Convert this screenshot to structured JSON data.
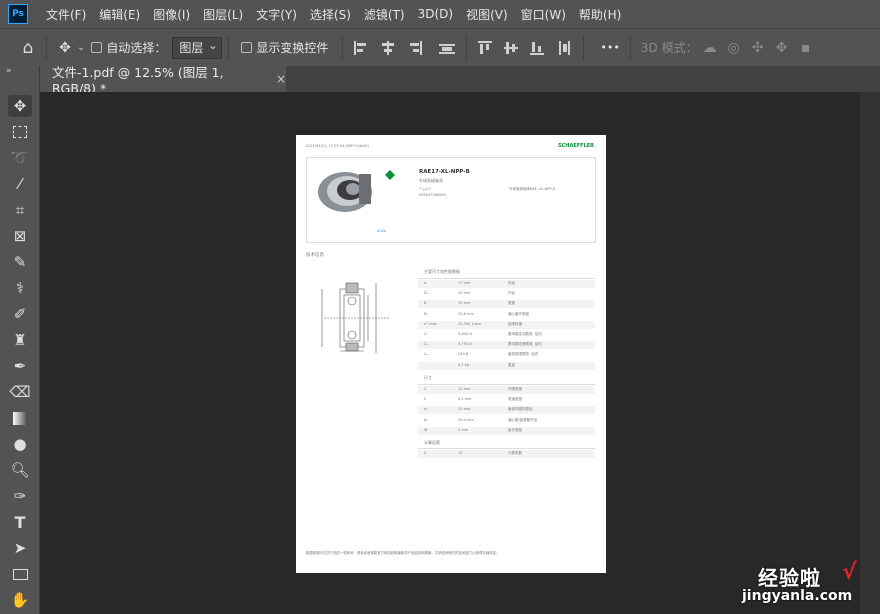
{
  "app": {
    "logo_text": "Ps"
  },
  "menu": [
    "文件(F)",
    "编辑(E)",
    "图像(I)",
    "图层(L)",
    "文字(Y)",
    "选择(S)",
    "滤镜(T)",
    "3D(D)",
    "视图(V)",
    "窗口(W)",
    "帮助(H)"
  ],
  "options": {
    "auto_select_label": "自动选择：",
    "layer_select_value": "图层",
    "show_transform_label": "显示变换控件",
    "more_label": "•••",
    "mode_3d_label": "3D 模式："
  },
  "document_tab": {
    "title": "文件-1.pdf @ 12.5% (图层 1, RGB/8) *",
    "close": "×"
  },
  "doc": {
    "timestamp": "2021/04/21, 17:25:04 (GMT+08:00)",
    "brand": "SCHAEFFLER",
    "product_name": "RAE17-XL-NPP-B",
    "product_sub": "外球面球轴承",
    "product_desc": "外球面球轴承RAE..XL-NPP-B",
    "order_label": "产品编号",
    "order_no": "039047580000",
    "xlife": "X-life",
    "section_tech": "技术信息",
    "table1_title": "主要尺寸和性能数据",
    "table1_rows": [
      [
        "d",
        "17 mm",
        "内径"
      ],
      [
        "Dₘ",
        "40 mm",
        "外径"
      ],
      [
        "B",
        "19 mm",
        "宽度"
      ],
      [
        "B₁",
        "20.6 mm",
        "偏心套环宽度"
      ],
      [
        "nᴳ max",
        "22,300 1/min",
        "极限转速"
      ],
      [
        "Cᵣ",
        "9,600 N",
        "基本额定动载荷, 径向"
      ],
      [
        "C₀ᵣ",
        "4,750 N",
        "基本额定静载荷, 径向"
      ],
      [
        "Cᵤᵣ",
        "240 N",
        "疲劳极限载荷, 径向"
      ],
      [
        "",
        "0.1 kg",
        "重量"
      ]
    ],
    "table2_title": "尺寸",
    "table2_rows": [
      [
        "C",
        "12 mm",
        "外圈宽度"
      ],
      [
        "S",
        "6.5 mm",
        "滚道宽度"
      ],
      [
        "d₁",
        "23 mm",
        "肩部内圈的直径"
      ],
      [
        "d₂",
        "26.4 mm",
        "偏心套/锁紧套外径"
      ],
      [
        "W",
        "3 mm",
        "扳手宽度"
      ]
    ],
    "table3_title": "计算因素",
    "table3_rows": [
      [
        "f₀",
        "13",
        "计算系数"
      ]
    ],
    "footnote": "数据和图示仅供产品的一般参考，请参阅舍弗勒官方网站获取最新的产品信息和规格，并请咨询我们的技术部门以获得详细信息。"
  },
  "watermark": {
    "main": "经验啦",
    "sub": "jingyanla.com",
    "check": "√"
  }
}
